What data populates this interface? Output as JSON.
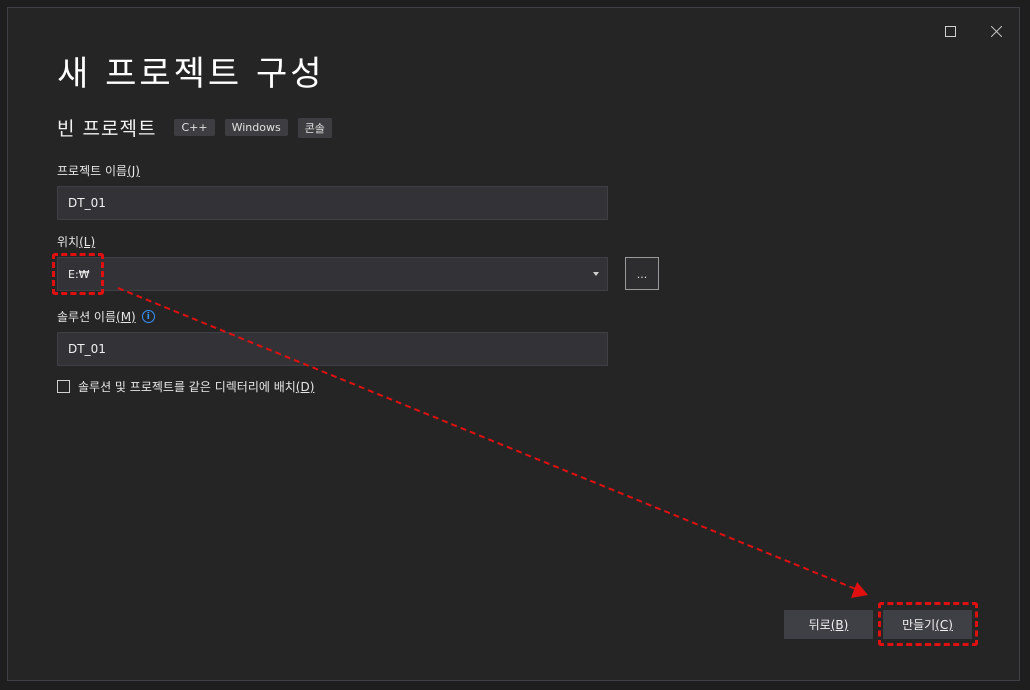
{
  "window_controls": {
    "maximize_icon": "maximize-icon",
    "close_icon": "close-icon"
  },
  "title": "새 프로젝트 구성",
  "template": {
    "name": "빈 프로젝트",
    "tags": [
      "C++",
      "Windows",
      "콘솔"
    ]
  },
  "project_name": {
    "label": "프로젝트 이름",
    "mnemonic": "(J)",
    "value": "DT_01"
  },
  "location": {
    "label": "위치",
    "mnemonic": "(L)",
    "value": "E:₩",
    "browse_label": "..."
  },
  "solution_name": {
    "label": "솔루션 이름",
    "mnemonic": "(M)",
    "info_icon": "info-icon",
    "value": "DT_01"
  },
  "same_directory": {
    "label": "솔루션 및 프로젝트를 같은 디렉터리에 배치",
    "mnemonic": "(D)",
    "checked": false
  },
  "buttons": {
    "back": {
      "label": "뒤로",
      "mnemonic": "(B)"
    },
    "create": {
      "label": "만들기",
      "mnemonic": "(C)"
    }
  },
  "annotation_color": "#e01010"
}
